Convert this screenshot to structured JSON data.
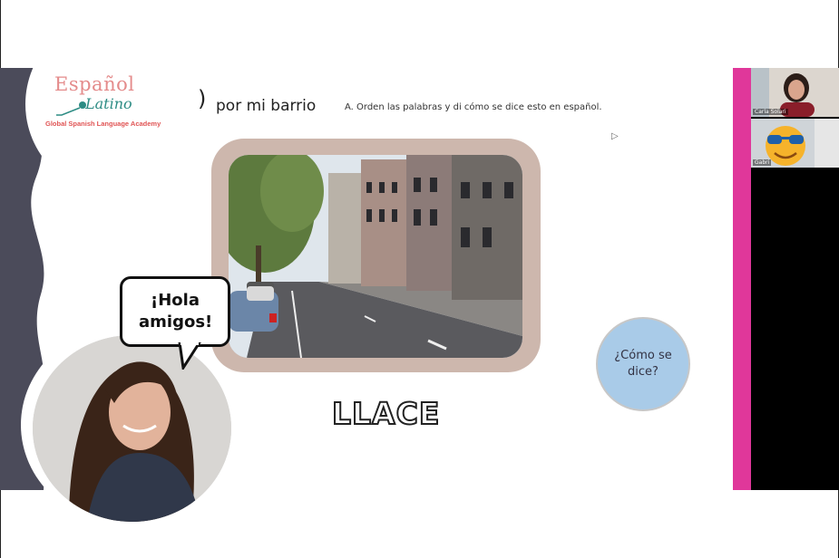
{
  "slide": {
    "logo": {
      "top_text": "Español",
      "middle_text": "Latino",
      "subtitle": "Global Spanish Language Academy"
    },
    "title_paren": ")",
    "title": "por mi barrio",
    "instruction": "A. Orden las palabras y di cómo se dice esto en español.",
    "como_se_dice": "¿Cómo se dice?",
    "scrambled_word": "LLACE",
    "speech_bubble": "¡Hola amigos!"
  },
  "participants": [
    {
      "name": "Carla Solari",
      "icon": "person-video"
    },
    {
      "name": "Gabri",
      "icon": "sunglasses-emoji"
    }
  ],
  "colors": {
    "accent_pink": "#e0379a",
    "frame_tan": "#cdb7ad",
    "bubble_blue": "#a9cbe8",
    "wave_gray": "#4b4b5a"
  }
}
